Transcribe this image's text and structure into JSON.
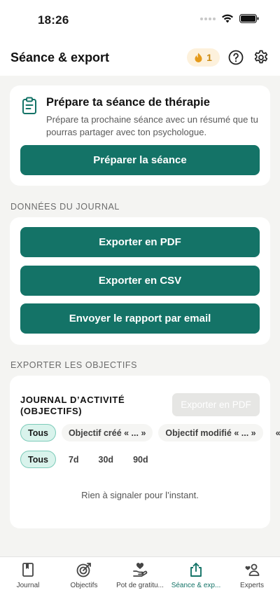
{
  "status_bar": {
    "time": "18:26"
  },
  "header": {
    "title": "Séance & export",
    "streak_count": "1",
    "icons": [
      "flame-icon",
      "help-icon",
      "gear-icon"
    ]
  },
  "therapy_card": {
    "title": "Prépare ta séance de thérapie",
    "description": "Prépare ta prochaine séance avec un résumé que tu pourras partager avec ton psychologue.",
    "button_label": "Préparer la séance"
  },
  "journal_section": {
    "label": "DONNÉES DU JOURNAL",
    "buttons": [
      "Exporter en PDF",
      "Exporter en CSV",
      "Envoyer le rapport par email"
    ]
  },
  "objectives_section": {
    "label": "EXPORTER LES OBJECTIFS",
    "card_title": "JOURNAL D’ACTIVITÉ (OBJECTIFS)",
    "export_button": "Exporter en PDF",
    "type_filters": [
      "Tous",
      "Objectif créé « ... »",
      "Objectif modifié « ... »",
      "«"
    ],
    "period_filters": [
      "Tous",
      "7d",
      "30d",
      "90d"
    ],
    "empty_message": "Rien à signaler pour l’instant."
  },
  "tab_bar": {
    "tabs": [
      {
        "label": "Journal",
        "icon": "book-icon"
      },
      {
        "label": "Objectifs",
        "icon": "target-icon"
      },
      {
        "label": "Pot de gratitu...",
        "icon": "heart-hand-icon"
      },
      {
        "label": "Séance & exp...",
        "icon": "share-icon",
        "active": true
      },
      {
        "label": "Experts",
        "icon": "people-icon"
      }
    ]
  },
  "colors": {
    "accent": "#147367",
    "background": "#f4f4f2",
    "streak": "#c98a12",
    "chip_active": "#d9f3ec"
  }
}
